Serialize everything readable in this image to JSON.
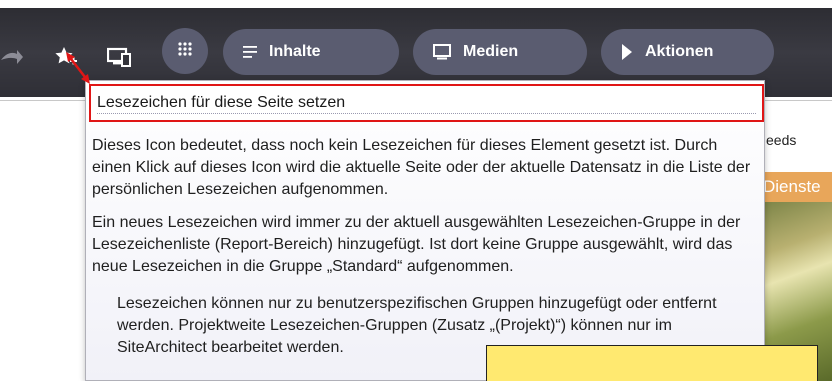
{
  "toolbar": {
    "icons": [
      "share-arrow-icon",
      "bookmark-star-add-icon",
      "devices-icon",
      "apps-grid-icon"
    ],
    "pills": [
      {
        "label": "Inhalte",
        "icon": "list-lines-icon"
      },
      {
        "label": "Medien",
        "icon": "monitor-icon"
      },
      {
        "label": "Aktionen",
        "icon": "play-triangle-icon"
      }
    ]
  },
  "tooltip": {
    "title": "Lesezeichen für diese Seite setzen",
    "paragraph1": "Dieses Icon bedeutet, dass noch kein Lesezeichen für dieses Element gesetzt ist. Durch einen Klick auf dieses Icon wird die aktuelle Seite oder der aktuelle Datensatz in die Liste der persönlichen Lesezeichen aufgenommen.",
    "paragraph2": "Ein neues Lesezeichen wird immer zu der aktuell ausgewählten Lesezeichen-Gruppe in der Lesezeichenliste (Report-Bereich) hinzugefügt. Ist dort keine Gruppe ausgewählt, wird das neue Lesezeichen in die Gruppe „Standard“ aufgenommen.",
    "paragraph3": "Lesezeichen können nur zu benutzerspezifischen Gruppen hinzugefügt oder entfernt werden. Projektweite Lesezeichen-Gruppen (Zusatz „(Projekt)“) können nur im SiteArchitect bearbeitet werden."
  },
  "background": {
    "feeds_fragment": "eeds",
    "dienste_fragment": "Dienste"
  },
  "colors": {
    "toolbar_bg": "#34343b",
    "pill_bg": "#5a5c70",
    "highlight_border": "#e01616",
    "annotation_box": "#ffe970",
    "dienste_tab": "#e8a65a"
  }
}
